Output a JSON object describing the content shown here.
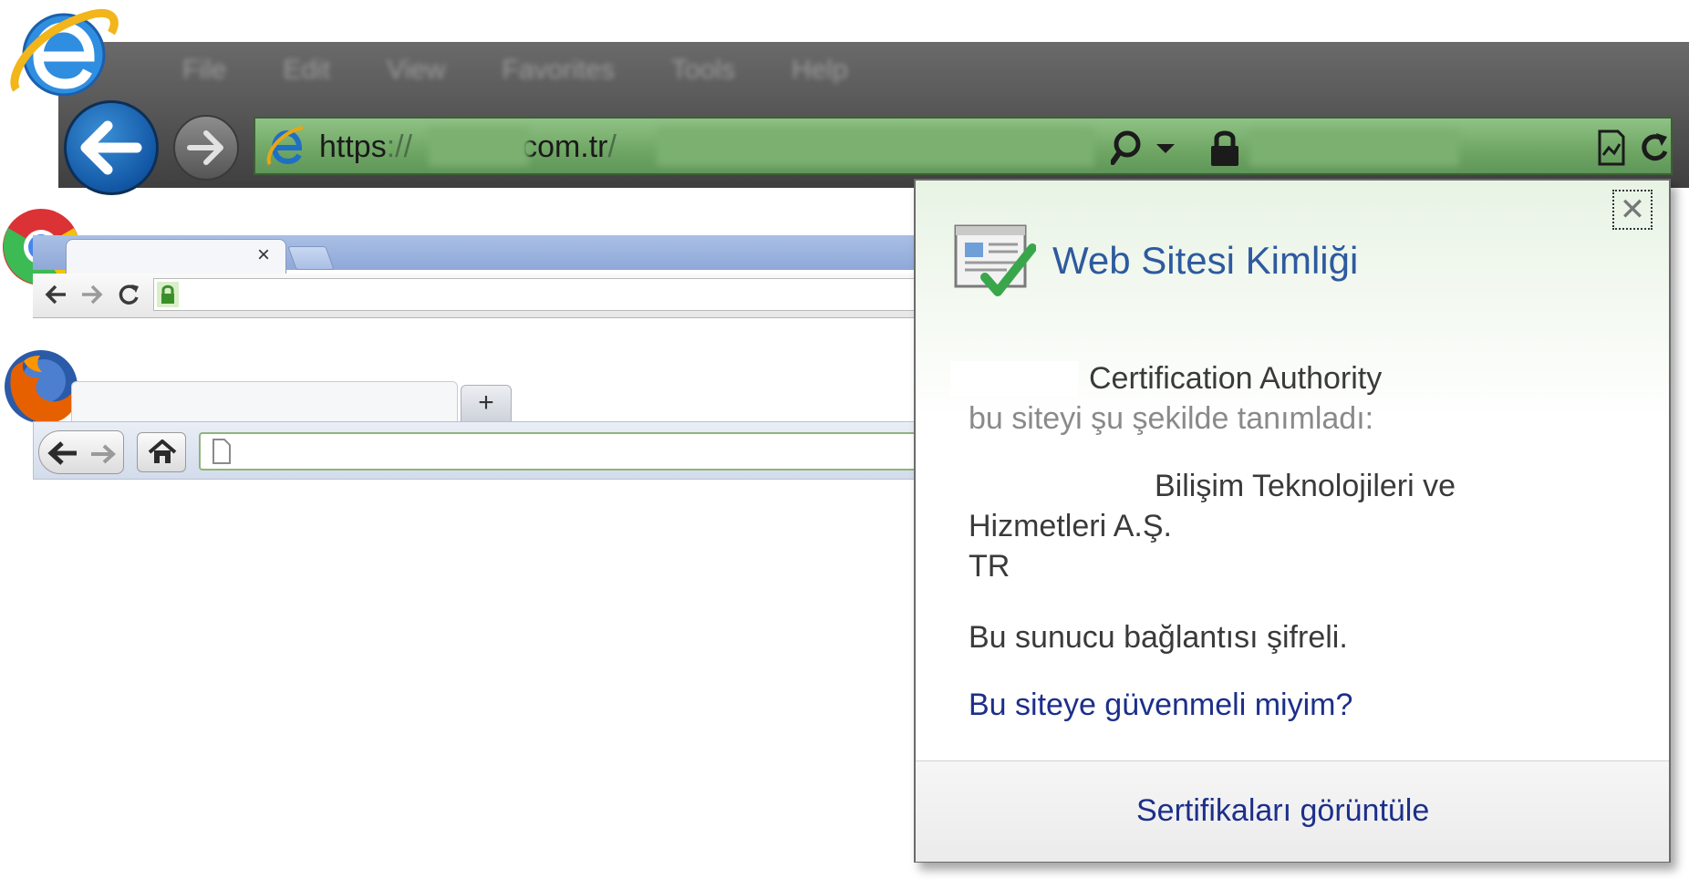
{
  "ie": {
    "menu": [
      "File",
      "Edit",
      "View",
      "Favorites",
      "Tools",
      "Help"
    ],
    "url_scheme": "https",
    "url_sep": "://",
    "url_tld": "com.tr",
    "url_slash": "/"
  },
  "chrome": {
    "tab_close": "×"
  },
  "firefox": {
    "new_tab": "+"
  },
  "popup": {
    "title": "Web Sitesi Kimliği",
    "issuer": "Certification Authority",
    "identified_as": "bu siteyi şu şekilde tanımladı:",
    "org_line1": "Bilişim Teknolojileri  ve",
    "org_line2": "Hizmetleri A.Ş.",
    "country": "TR",
    "encrypted": "Bu sunucu bağlantısı şifreli.",
    "trust_link": "Bu siteye güvenmeli miyim?",
    "view_certs": "Sertifikaları görüntüle",
    "close": "✕"
  },
  "colors": {
    "ie_address_green": "#7bb070",
    "ie_blue": "#1257a5",
    "popup_link": "#1c2f8a",
    "popup_header_tint": "#e8f3e4"
  }
}
